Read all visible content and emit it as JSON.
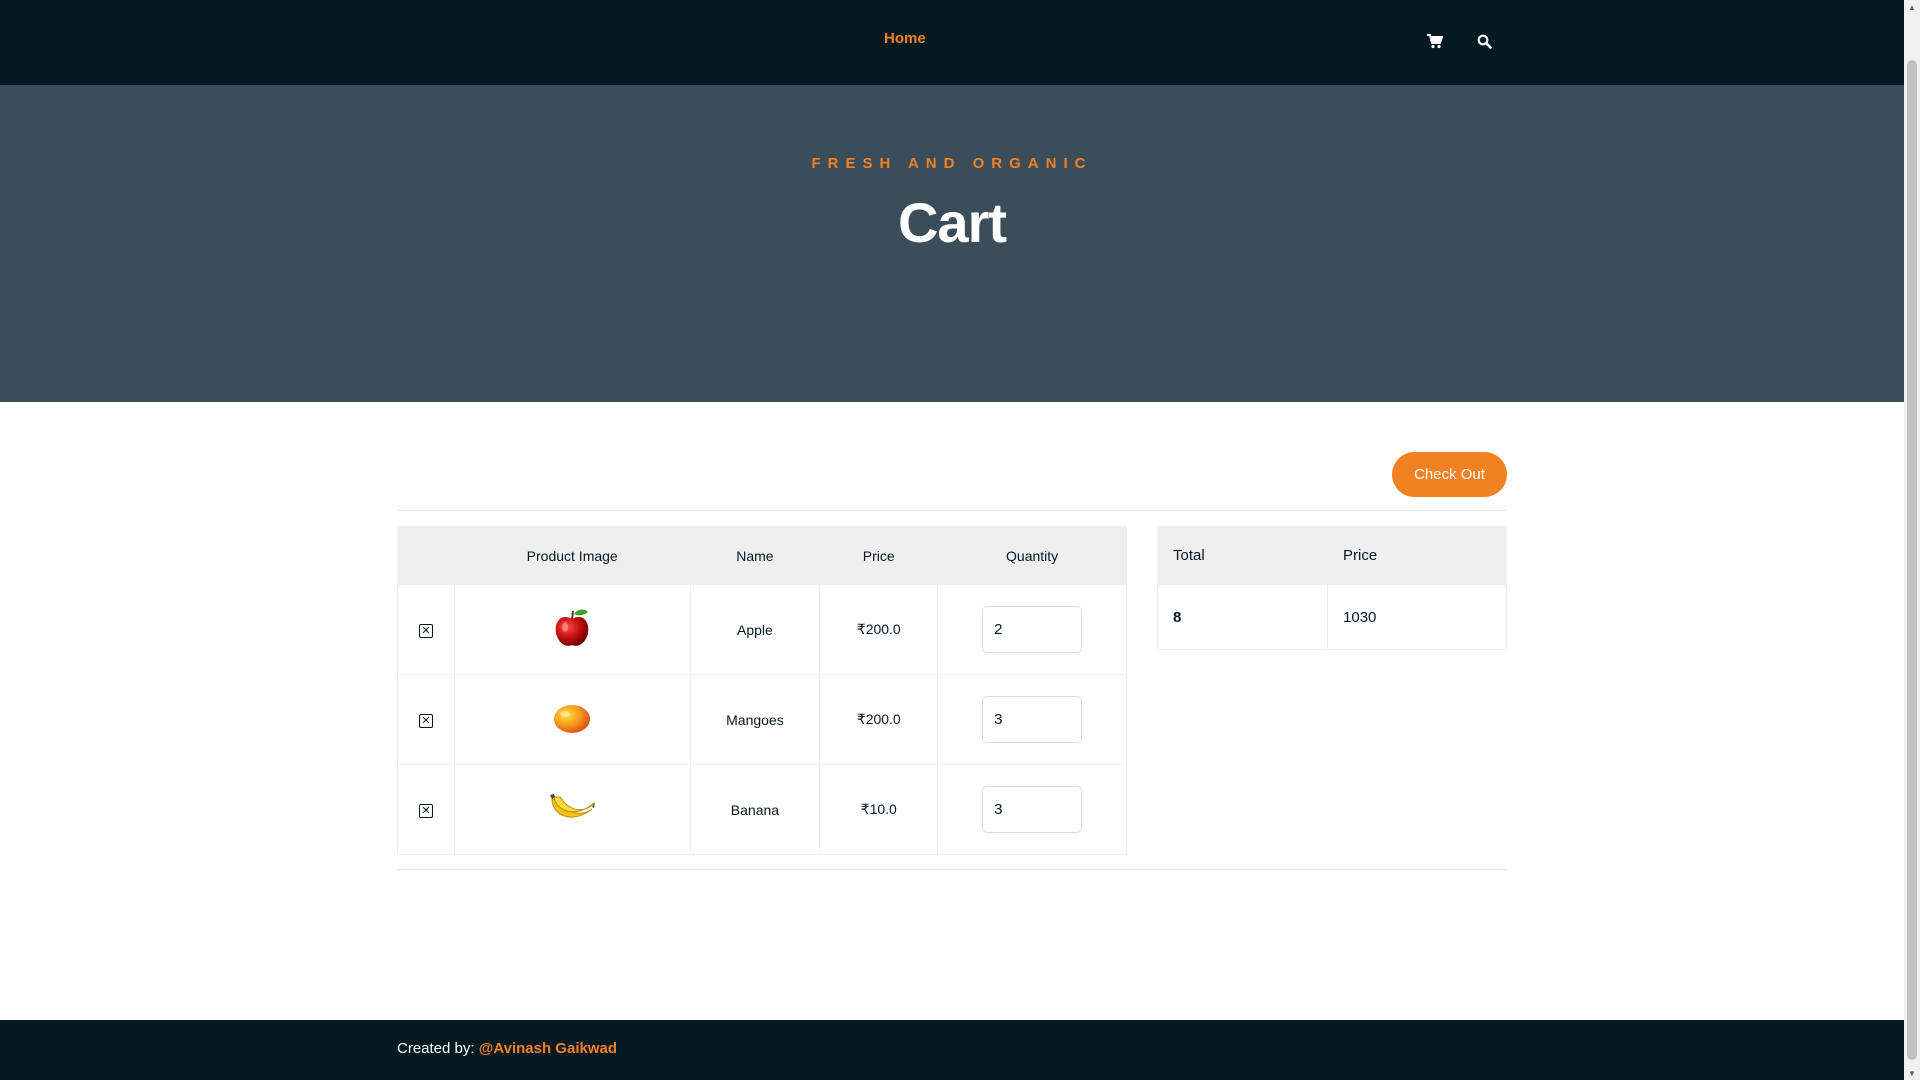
{
  "nav": {
    "home_label": "Home",
    "cart_icon": "shopping-cart-icon",
    "search_icon": "search-icon"
  },
  "hero": {
    "subtitle": "FRESH AND ORGANIC",
    "title": "Cart"
  },
  "checkout": {
    "label": "Check Out"
  },
  "cart_table": {
    "headers": [
      "",
      "Product Image",
      "Name",
      "Price",
      "Quantity"
    ],
    "rows": [
      {
        "name": "Apple",
        "price": "₹200.0",
        "quantity": "2",
        "image": "apple"
      },
      {
        "name": "Mangoes",
        "price": "₹200.0",
        "quantity": "3",
        "image": "mango"
      },
      {
        "name": "Banana",
        "price": "₹10.0",
        "quantity": "3",
        "image": "banana"
      }
    ]
  },
  "total_table": {
    "headers": [
      "Total",
      "Price"
    ],
    "total_quantity": "8",
    "total_price": "1030"
  },
  "footer": {
    "prefix": "Created by: ",
    "author": "@Avinash Gaikwad"
  },
  "colors": {
    "accent": "#F28123",
    "dark": "#051922",
    "hero_bg": "#3a4d59"
  }
}
